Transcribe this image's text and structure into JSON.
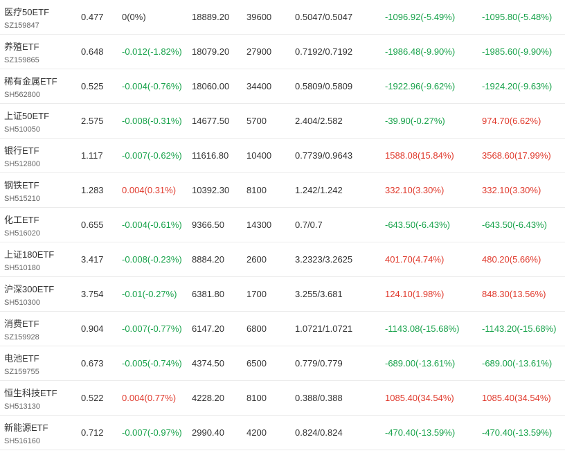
{
  "colors": {
    "up": "#e03a2d",
    "down": "#17a24a",
    "flat": "#333333"
  },
  "rows": [
    {
      "name": "医疗50ETF",
      "code": "SZ159847",
      "price": "0.477",
      "change": "0(0%)",
      "change_dir": "flat",
      "amount": "18889.20",
      "volume": "39600",
      "bid_ask": "0.5047/0.5047",
      "pl1": "-1096.92(-5.49%)",
      "pl1_dir": "down",
      "pl2": "-1095.80(-5.48%)",
      "pl2_dir": "down"
    },
    {
      "name": "养殖ETF",
      "code": "SZ159865",
      "price": "0.648",
      "change": "-0.012(-1.82%)",
      "change_dir": "down",
      "amount": "18079.20",
      "volume": "27900",
      "bid_ask": "0.7192/0.7192",
      "pl1": "-1986.48(-9.90%)",
      "pl1_dir": "down",
      "pl2": "-1985.60(-9.90%)",
      "pl2_dir": "down"
    },
    {
      "name": "稀有金属ETF",
      "code": "SH562800",
      "price": "0.525",
      "change": "-0.004(-0.76%)",
      "change_dir": "down",
      "amount": "18060.00",
      "volume": "34400",
      "bid_ask": "0.5809/0.5809",
      "pl1": "-1922.96(-9.62%)",
      "pl1_dir": "down",
      "pl2": "-1924.20(-9.63%)",
      "pl2_dir": "down"
    },
    {
      "name": "上证50ETF",
      "code": "SH510050",
      "price": "2.575",
      "change": "-0.008(-0.31%)",
      "change_dir": "down",
      "amount": "14677.50",
      "volume": "5700",
      "bid_ask": "2.404/2.582",
      "pl1": "-39.90(-0.27%)",
      "pl1_dir": "down",
      "pl2": "974.70(6.62%)",
      "pl2_dir": "up"
    },
    {
      "name": "银行ETF",
      "code": "SH512800",
      "price": "1.117",
      "change": "-0.007(-0.62%)",
      "change_dir": "down",
      "amount": "11616.80",
      "volume": "10400",
      "bid_ask": "0.7739/0.9643",
      "pl1": "1588.08(15.84%)",
      "pl1_dir": "up",
      "pl2": "3568.60(17.99%)",
      "pl2_dir": "up"
    },
    {
      "name": "钢铁ETF",
      "code": "SH515210",
      "price": "1.283",
      "change": "0.004(0.31%)",
      "change_dir": "up",
      "amount": "10392.30",
      "volume": "8100",
      "bid_ask": "1.242/1.242",
      "pl1": "332.10(3.30%)",
      "pl1_dir": "up",
      "pl2": "332.10(3.30%)",
      "pl2_dir": "up"
    },
    {
      "name": "化工ETF",
      "code": "SH516020",
      "price": "0.655",
      "change": "-0.004(-0.61%)",
      "change_dir": "down",
      "amount": "9366.50",
      "volume": "14300",
      "bid_ask": "0.7/0.7",
      "pl1": "-643.50(-6.43%)",
      "pl1_dir": "down",
      "pl2": "-643.50(-6.43%)",
      "pl2_dir": "down"
    },
    {
      "name": "上证180ETF",
      "code": "SH510180",
      "price": "3.417",
      "change": "-0.008(-0.23%)",
      "change_dir": "down",
      "amount": "8884.20",
      "volume": "2600",
      "bid_ask": "3.2323/3.2625",
      "pl1": "401.70(4.74%)",
      "pl1_dir": "up",
      "pl2": "480.20(5.66%)",
      "pl2_dir": "up"
    },
    {
      "name": "沪深300ETF",
      "code": "SH510300",
      "price": "3.754",
      "change": "-0.01(-0.27%)",
      "change_dir": "down",
      "amount": "6381.80",
      "volume": "1700",
      "bid_ask": "3.255/3.681",
      "pl1": "124.10(1.98%)",
      "pl1_dir": "up",
      "pl2": "848.30(13.56%)",
      "pl2_dir": "up"
    },
    {
      "name": "消费ETF",
      "code": "SZ159928",
      "price": "0.904",
      "change": "-0.007(-0.77%)",
      "change_dir": "down",
      "amount": "6147.20",
      "volume": "6800",
      "bid_ask": "1.0721/1.0721",
      "pl1": "-1143.08(-15.68%)",
      "pl1_dir": "down",
      "pl2": "-1143.20(-15.68%)",
      "pl2_dir": "down"
    },
    {
      "name": "电池ETF",
      "code": "SZ159755",
      "price": "0.673",
      "change": "-0.005(-0.74%)",
      "change_dir": "down",
      "amount": "4374.50",
      "volume": "6500",
      "bid_ask": "0.779/0.779",
      "pl1": "-689.00(-13.61%)",
      "pl1_dir": "down",
      "pl2": "-689.00(-13.61%)",
      "pl2_dir": "down"
    },
    {
      "name": "恒生科技ETF",
      "code": "SH513130",
      "price": "0.522",
      "change": "0.004(0.77%)",
      "change_dir": "up",
      "amount": "4228.20",
      "volume": "8100",
      "bid_ask": "0.388/0.388",
      "pl1": "1085.40(34.54%)",
      "pl1_dir": "up",
      "pl2": "1085.40(34.54%)",
      "pl2_dir": "up"
    },
    {
      "name": "新能源ETF",
      "code": "SH516160",
      "price": "0.712",
      "change": "-0.007(-0.97%)",
      "change_dir": "down",
      "amount": "2990.40",
      "volume": "4200",
      "bid_ask": "0.824/0.824",
      "pl1": "-470.40(-13.59%)",
      "pl1_dir": "down",
      "pl2": "-470.40(-13.59%)",
      "pl2_dir": "down"
    }
  ]
}
